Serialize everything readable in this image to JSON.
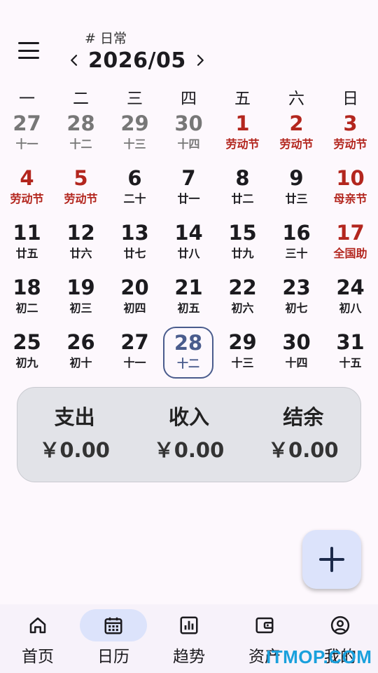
{
  "header": {
    "book": "# 日常",
    "month": "2026/05"
  },
  "weekdays": [
    "一",
    "二",
    "三",
    "四",
    "五",
    "六",
    "日"
  ],
  "colors": {
    "holiday": "#b3261e",
    "other_month": "#777777",
    "today": "#4a5c8d",
    "accent_container": "#dce3fb"
  },
  "weeks": [
    [
      {
        "day": "27",
        "lunar": "十一",
        "type": "other"
      },
      {
        "day": "28",
        "lunar": "十二",
        "type": "other"
      },
      {
        "day": "29",
        "lunar": "十三",
        "type": "other"
      },
      {
        "day": "30",
        "lunar": "十四",
        "type": "other"
      },
      {
        "day": "1",
        "lunar": "劳动节",
        "type": "holiday"
      },
      {
        "day": "2",
        "lunar": "劳动节",
        "type": "holiday"
      },
      {
        "day": "3",
        "lunar": "劳动节",
        "type": "holiday"
      }
    ],
    [
      {
        "day": "4",
        "lunar": "劳动节",
        "type": "holiday"
      },
      {
        "day": "5",
        "lunar": "劳动节",
        "type": "holiday"
      },
      {
        "day": "6",
        "lunar": "二十",
        "type": "normal"
      },
      {
        "day": "7",
        "lunar": "廿一",
        "type": "normal"
      },
      {
        "day": "8",
        "lunar": "廿二",
        "type": "normal"
      },
      {
        "day": "9",
        "lunar": "廿三",
        "type": "normal"
      },
      {
        "day": "10",
        "lunar": "母亲节",
        "type": "holiday"
      }
    ],
    [
      {
        "day": "11",
        "lunar": "廿五",
        "type": "normal"
      },
      {
        "day": "12",
        "lunar": "廿六",
        "type": "normal"
      },
      {
        "day": "13",
        "lunar": "廿七",
        "type": "normal"
      },
      {
        "day": "14",
        "lunar": "廿八",
        "type": "normal"
      },
      {
        "day": "15",
        "lunar": "廿九",
        "type": "normal"
      },
      {
        "day": "16",
        "lunar": "三十",
        "type": "normal"
      },
      {
        "day": "17",
        "lunar": "全国助",
        "type": "holiday"
      }
    ],
    [
      {
        "day": "18",
        "lunar": "初二",
        "type": "normal"
      },
      {
        "day": "19",
        "lunar": "初三",
        "type": "normal"
      },
      {
        "day": "20",
        "lunar": "初四",
        "type": "normal"
      },
      {
        "day": "21",
        "lunar": "初五",
        "type": "normal"
      },
      {
        "day": "22",
        "lunar": "初六",
        "type": "normal"
      },
      {
        "day": "23",
        "lunar": "初七",
        "type": "normal"
      },
      {
        "day": "24",
        "lunar": "初八",
        "type": "normal"
      }
    ],
    [
      {
        "day": "25",
        "lunar": "初九",
        "type": "normal"
      },
      {
        "day": "26",
        "lunar": "初十",
        "type": "normal"
      },
      {
        "day": "27",
        "lunar": "十一",
        "type": "normal"
      },
      {
        "day": "28",
        "lunar": "十二",
        "type": "today"
      },
      {
        "day": "29",
        "lunar": "十三",
        "type": "normal"
      },
      {
        "day": "30",
        "lunar": "十四",
        "type": "normal"
      },
      {
        "day": "31",
        "lunar": "十五",
        "type": "normal"
      }
    ]
  ],
  "summary": {
    "expense_label": "支出",
    "expense_value": "￥0.00",
    "income_label": "收入",
    "income_value": "￥0.00",
    "balance_label": "结余",
    "balance_value": "￥0.00"
  },
  "fab": {
    "icon": "plus-icon"
  },
  "nav": [
    {
      "label": "首页",
      "icon": "home-icon",
      "active": false
    },
    {
      "label": "日历",
      "icon": "calendar-icon",
      "active": true
    },
    {
      "label": "趋势",
      "icon": "chart-icon",
      "active": false
    },
    {
      "label": "资产",
      "icon": "wallet-icon",
      "active": false
    },
    {
      "label": "我的",
      "icon": "profile-icon",
      "active": false
    }
  ],
  "watermark": "ITMOP.COM"
}
